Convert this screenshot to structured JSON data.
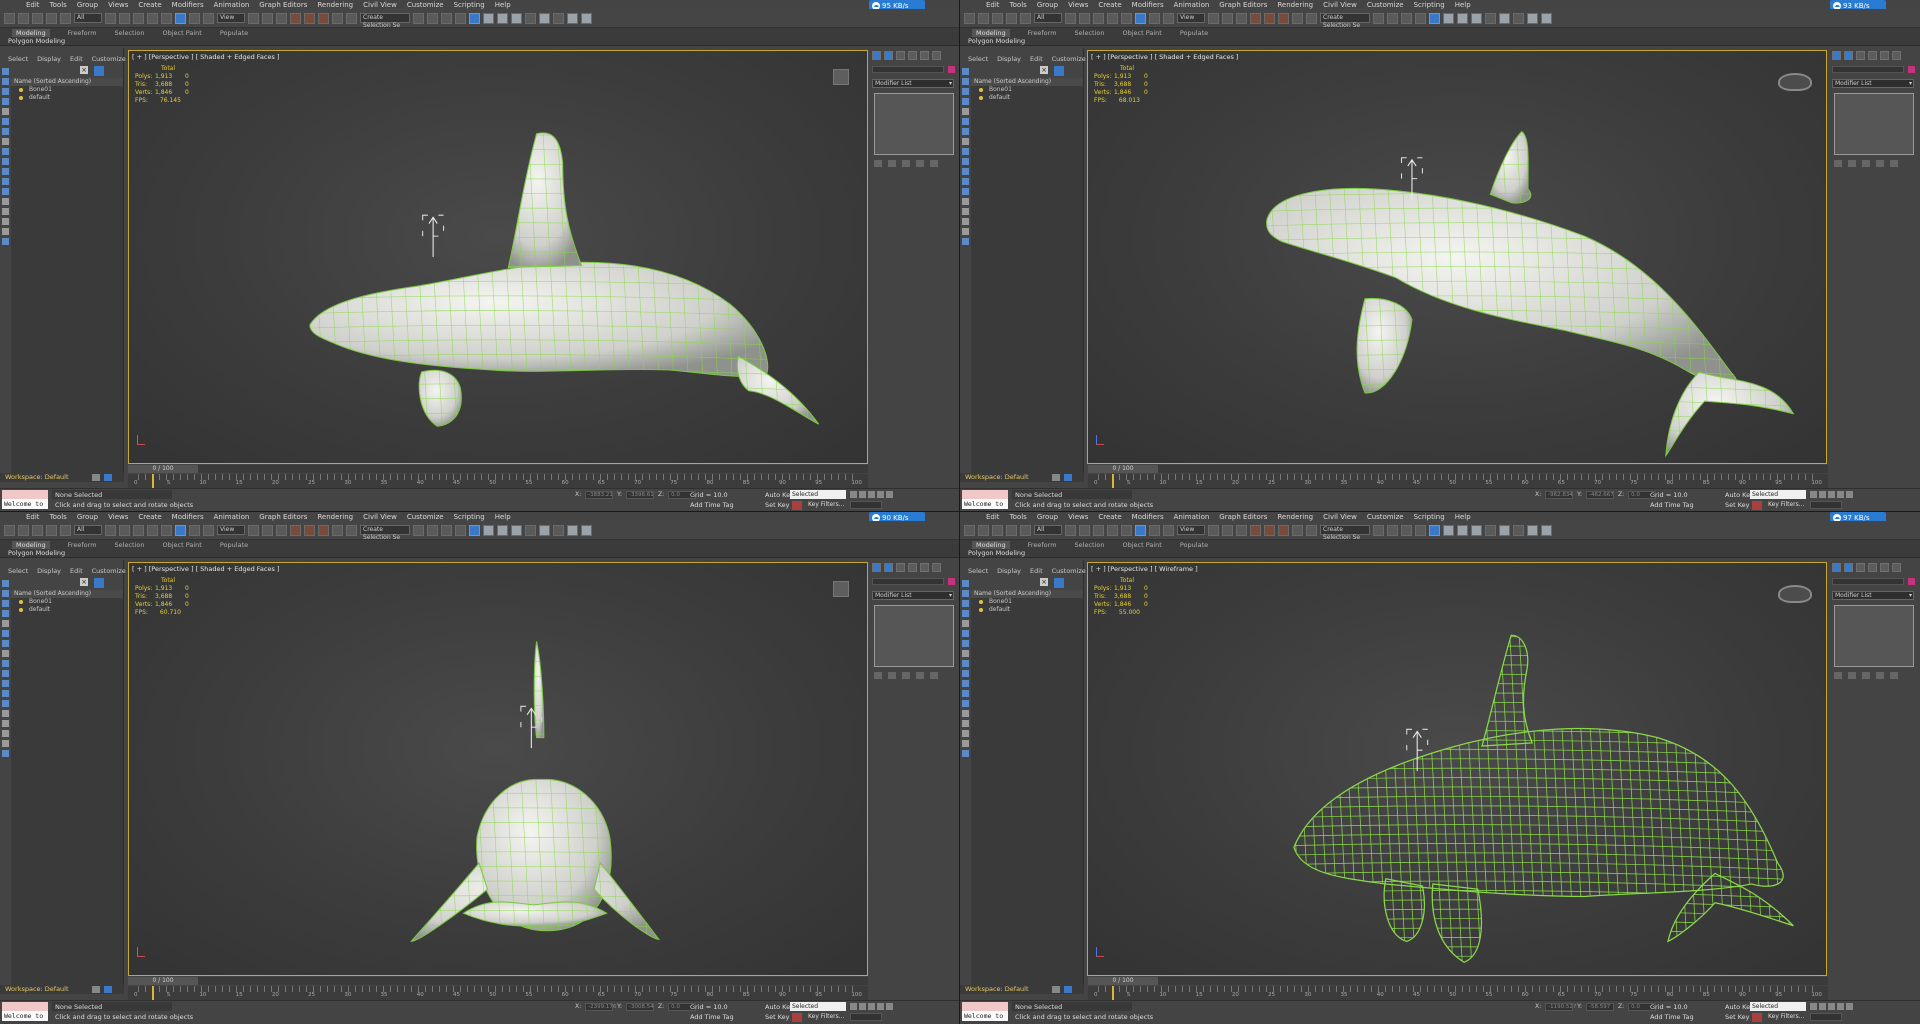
{
  "menu": [
    "Edit",
    "Tools",
    "Group",
    "Views",
    "Create",
    "Modifiers",
    "Animation",
    "Graph Editors",
    "Rendering",
    "Civil View",
    "Customize",
    "Scripting",
    "Help"
  ],
  "toolbar": {
    "selection_filter": "All",
    "ref_coord": "View",
    "named_selection": "Create Selection Se"
  },
  "ribbon": {
    "tabs": [
      "Modeling",
      "Freeform",
      "Selection",
      "Object Paint",
      "Populate"
    ],
    "sub": "Polygon Modeling"
  },
  "scene_explorer": {
    "menu": [
      "Select",
      "Display",
      "Edit",
      "Customize"
    ],
    "header": "Name (Sorted Ascending)",
    "rows": [
      "Bone01",
      "default"
    ]
  },
  "command_panel": {
    "modifier_list": "Modifier List",
    "accent_color": "#c8327a"
  },
  "stats": {
    "total_label": "Total",
    "polys_label": "Polys:",
    "polys": "1,913",
    "tris_label": "Tris:",
    "tris": "3,688",
    "verts_label": "Verts:",
    "verts": "1,846",
    "zero": "0",
    "fps_label": "FPS:"
  },
  "time": {
    "slider": "0 / 100",
    "ticks": [
      "0",
      "5",
      "10",
      "15",
      "20",
      "25",
      "30",
      "35",
      "40",
      "45",
      "50",
      "55",
      "60",
      "65",
      "70",
      "75",
      "80",
      "85",
      "90",
      "95",
      "100"
    ]
  },
  "workspace": "Workspace: Default",
  "status": {
    "none_selected": "None Selected",
    "hint": "Click and drag to select and rotate objects",
    "welcome": "Welcome to M",
    "x_label": "X:",
    "y_label": "Y:",
    "z_label": "Z:",
    "grid": "Grid = 10.0",
    "add_time_tag": "Add Time Tag",
    "auto_key": "Auto Key",
    "set_key": "Set Key",
    "selected": "Selected",
    "key_filters": "Key Filters..."
  },
  "quadrants": [
    {
      "net_speed": "95 KB/s",
      "viewport_label": "[ + ] [Perspective ] [ Shaded + Edged Faces ]",
      "fps": "76.145",
      "x": "-3883.21",
      "y": "-3396.61",
      "z": "0.0"
    },
    {
      "net_speed": "93 KB/s",
      "viewport_label": "[ + ] [Perspective ] [ Shaded + Edged Faces ]",
      "fps": "68.013",
      "x": "-962.834",
      "y": "-462.667",
      "z": "0.0"
    },
    {
      "net_speed": "90 KB/s",
      "viewport_label": "[ + ] [Perspective ] [ Shaded + Edged Faces ]",
      "fps": "60.710",
      "x": "-2399.176",
      "y": "-3008.54",
      "z": "0.0"
    },
    {
      "net_speed": "97 KB/s",
      "viewport_label": "[ + ] [Perspective ] [ Wireframe ]",
      "fps": "55.000",
      "x": "-1190.527",
      "y": "-58.597",
      "z": "0.0"
    }
  ],
  "colors": {
    "accent": "#3a78c8",
    "viewport_border": "#c8a832",
    "wire": "#8ad84a",
    "stats": "#e6d030"
  }
}
